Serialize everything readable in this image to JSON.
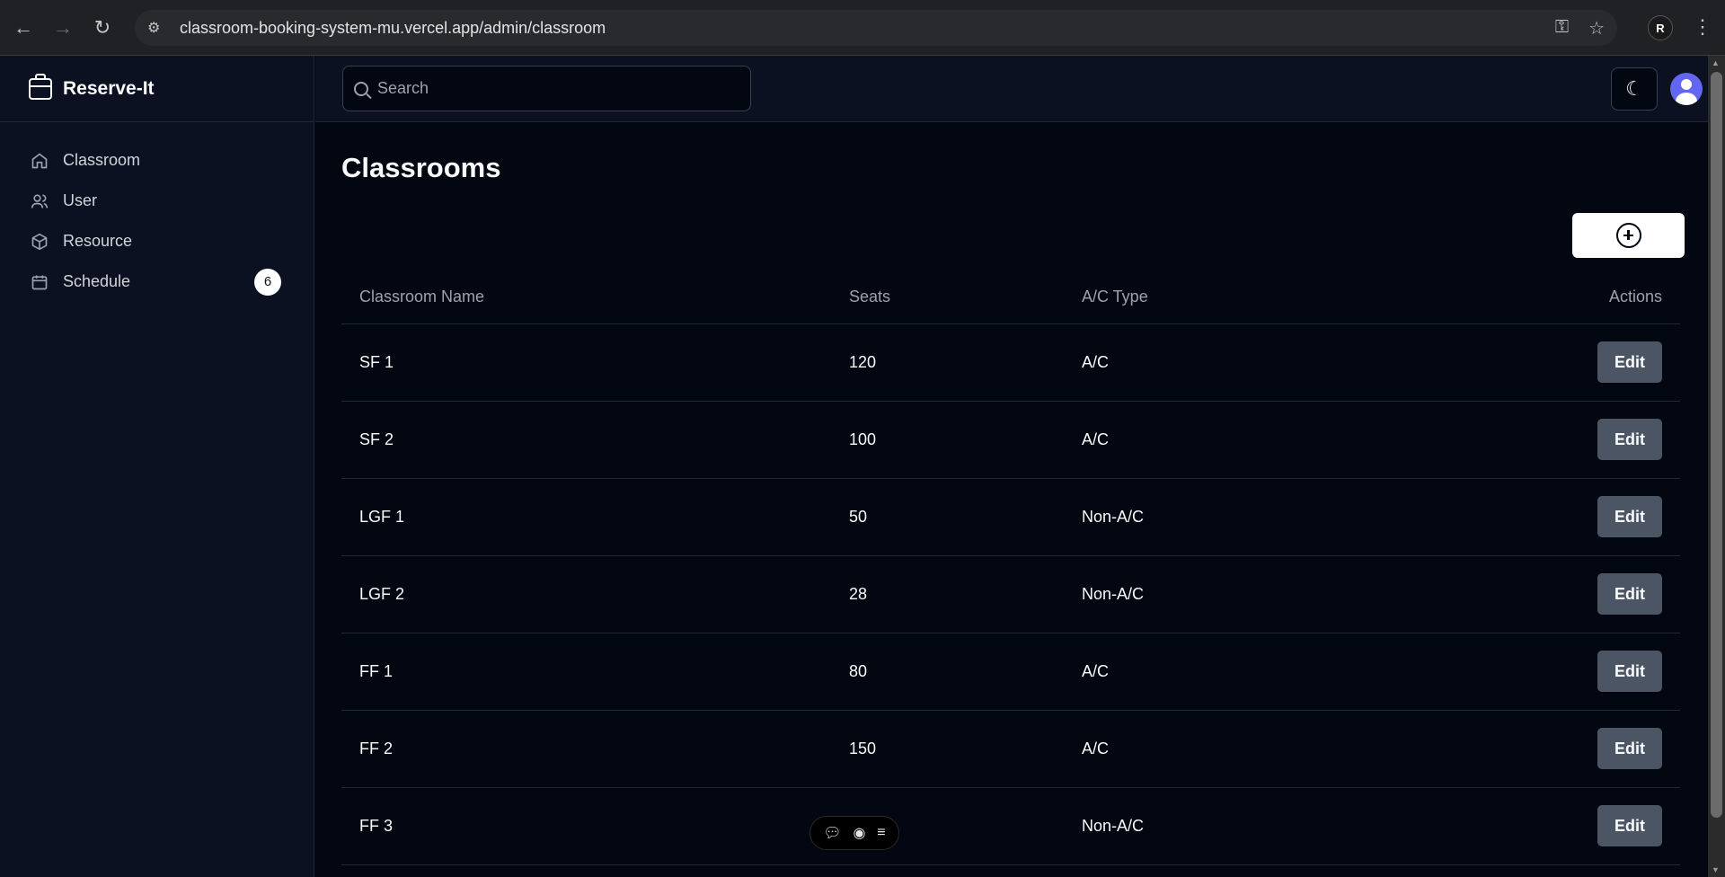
{
  "browser": {
    "url": "classroom-booking-system-mu.vercel.app/admin/classroom",
    "extension_letter": "R"
  },
  "sidebar": {
    "brand": "Reserve-It",
    "items": [
      {
        "label": "Classroom",
        "icon": "home-icon"
      },
      {
        "label": "User",
        "icon": "users-icon"
      },
      {
        "label": "Resource",
        "icon": "package-icon"
      },
      {
        "label": "Schedule",
        "icon": "calendar-icon",
        "badge": "6"
      }
    ]
  },
  "header": {
    "search_placeholder": "Search"
  },
  "main": {
    "title": "Classrooms",
    "columns": [
      "Classroom Name",
      "Seats",
      "A/C Type",
      "Actions"
    ],
    "rows": [
      {
        "name": "SF 1",
        "seats": "120",
        "ac": "A/C",
        "action": "Edit"
      },
      {
        "name": "SF 2",
        "seats": "100",
        "ac": "A/C",
        "action": "Edit"
      },
      {
        "name": "LGF 1",
        "seats": "50",
        "ac": "Non-A/C",
        "action": "Edit"
      },
      {
        "name": "LGF 2",
        "seats": "28",
        "ac": "Non-A/C",
        "action": "Edit"
      },
      {
        "name": "FF 1",
        "seats": "80",
        "ac": "A/C",
        "action": "Edit"
      },
      {
        "name": "FF 2",
        "seats": "150",
        "ac": "A/C",
        "action": "Edit"
      },
      {
        "name": "FF 3",
        "seats": "",
        "ac": "Non-A/C",
        "action": "Edit"
      }
    ]
  },
  "colors": {
    "background": "#030712",
    "sidebar": "#0b1120",
    "edit_button": "#4b5563",
    "avatar": "#6366f1"
  }
}
